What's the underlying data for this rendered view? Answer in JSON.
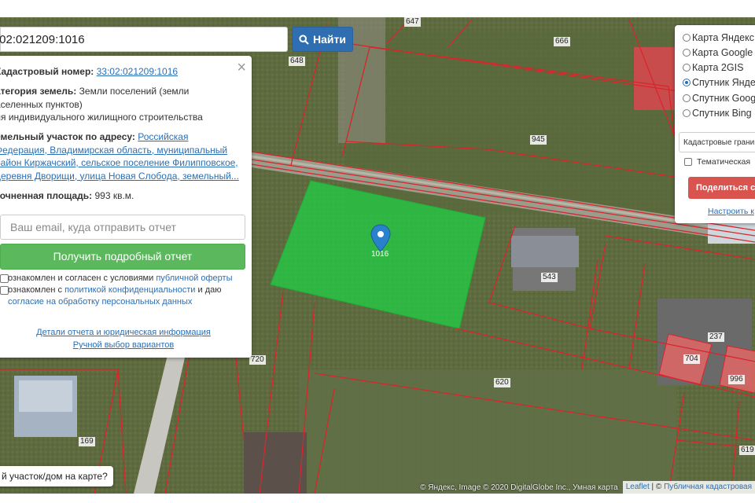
{
  "search": {
    "value": ":02:021209:1016",
    "button_label": "Найти"
  },
  "info_panel": {
    "cadnum_label": "Кадастровый номер:",
    "cadnum_value": "33:02:021209:1016",
    "category_label": "атегория земель:",
    "category_line1": "Земли поселений (земли",
    "category_line2": "аселенных пунктов)",
    "category_line3": "ля индивидуального жилищного строительства",
    "address_label": "емельный участок по адресу:",
    "address_link1": "Российская",
    "address_link2": "Федерация, Владимирская область, муниципальный",
    "address_link3": "район Киржачский, сельское поселение Филипповское,",
    "address_link4": "деревня Дворищи, улица Новая Слобода, земельный...",
    "area_label": "точненная площадь:",
    "area_value": "993 кв.м.",
    "email_placeholder": "Ваш email, куда отправить отчет",
    "get_report_button": "Получить подробный отчет",
    "agree1_text": "ознакомлен и согласен с условиями ",
    "agree1_link": "публичной оферты",
    "agree2_text": "ознакомлен с ",
    "agree2_link": "политикой конфиденциальности",
    "agree2_text2": " и даю",
    "agree2_link2": "согласие на обработку персональных данных",
    "details_link": "Детали отчета и юридическая информация",
    "manual_link": "Ручной выбор вариантов"
  },
  "bottom_question": "й участок/дом на карте?",
  "layers": {
    "options": [
      {
        "label": "Карта Яндекс",
        "selected": false
      },
      {
        "label": "Карта Google",
        "selected": false
      },
      {
        "label": "Карта 2GIS",
        "selected": false
      },
      {
        "label": "Спутник Яндекс",
        "selected": true
      },
      {
        "label": "Спутник Google",
        "selected": false
      },
      {
        "label": "Спутник Bing",
        "selected": false
      }
    ],
    "select_value": "Кадастровые границы",
    "thematic_label": "Тематическая",
    "share_button": "Поделиться с",
    "setup_link": "Настроить к"
  },
  "attribution": {
    "yandex": "© Яндекс, Image © 2020 DigitalGlobe Inc., Умная карта",
    "leaflet": "Leaflet",
    "sep": " | © ",
    "public_map": "Публичная кадастровая"
  },
  "parcel_labels": [
    "647",
    "666",
    "648",
    "945",
    "1016",
    "543",
    "237",
    "704",
    "996",
    "720",
    "620",
    "169",
    "619"
  ],
  "colors": {
    "selected_parcel": "#22cc44",
    "boundary": "#d8262c",
    "highlight": "#e06666",
    "accent_blue": "#2f6eb0",
    "green_btn": "#5cb85c",
    "share_red": "#d9534f"
  }
}
